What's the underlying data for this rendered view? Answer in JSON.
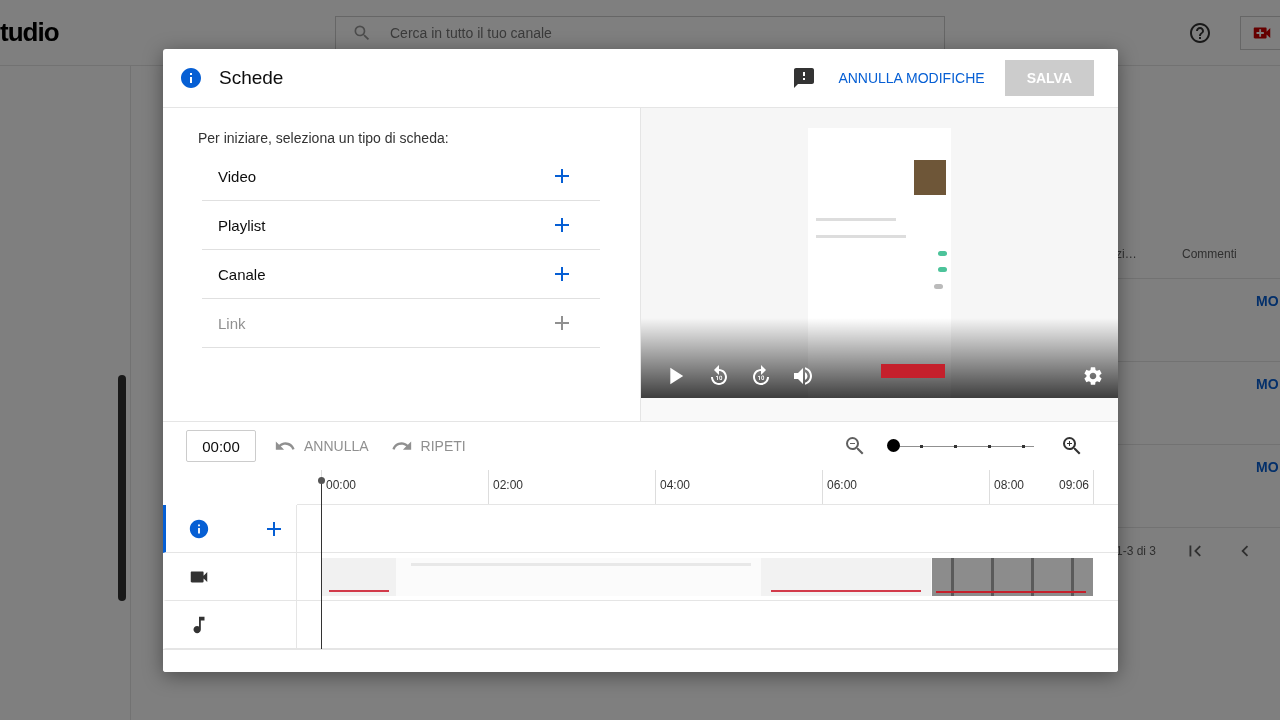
{
  "app": {
    "logo_text": "tudio",
    "search": {
      "placeholder": "Cerca in tutto il tuo canale"
    }
  },
  "table": {
    "columns": [
      "zi…",
      "Commenti"
    ],
    "rows": [
      {
        "action": "MO"
      },
      {
        "action": "MO"
      },
      {
        "action": "MO"
      }
    ],
    "pagination": {
      "range": "1-3 di 3"
    }
  },
  "dialog": {
    "title": "Schede",
    "actions": [
      {
        "label": "ANNULLA MODIFICHE",
        "disabled": false
      },
      {
        "label": "SALVA",
        "disabled": true
      }
    ],
    "prompt": "Per iniziare, seleziona un tipo di scheda:",
    "card_types": [
      {
        "label": "Video",
        "disabled": false
      },
      {
        "label": "Playlist",
        "disabled": false
      },
      {
        "label": "Canale",
        "disabled": false
      },
      {
        "label": "Link",
        "disabled": true
      }
    ],
    "timeline": {
      "time": "00:00",
      "undo": {
        "label": "ANNULLA",
        "disabled": true
      },
      "redo": {
        "label": "RIPETI",
        "disabled": true
      },
      "zoom": {
        "level": 0
      },
      "ruler": [
        "00:00",
        "02:00",
        "04:00",
        "06:00",
        "08:00",
        "09:06"
      ],
      "tracks": [
        {
          "kind": "cards",
          "selected": true
        },
        {
          "kind": "video",
          "selected": false
        },
        {
          "kind": "audio",
          "selected": false
        }
      ]
    }
  }
}
